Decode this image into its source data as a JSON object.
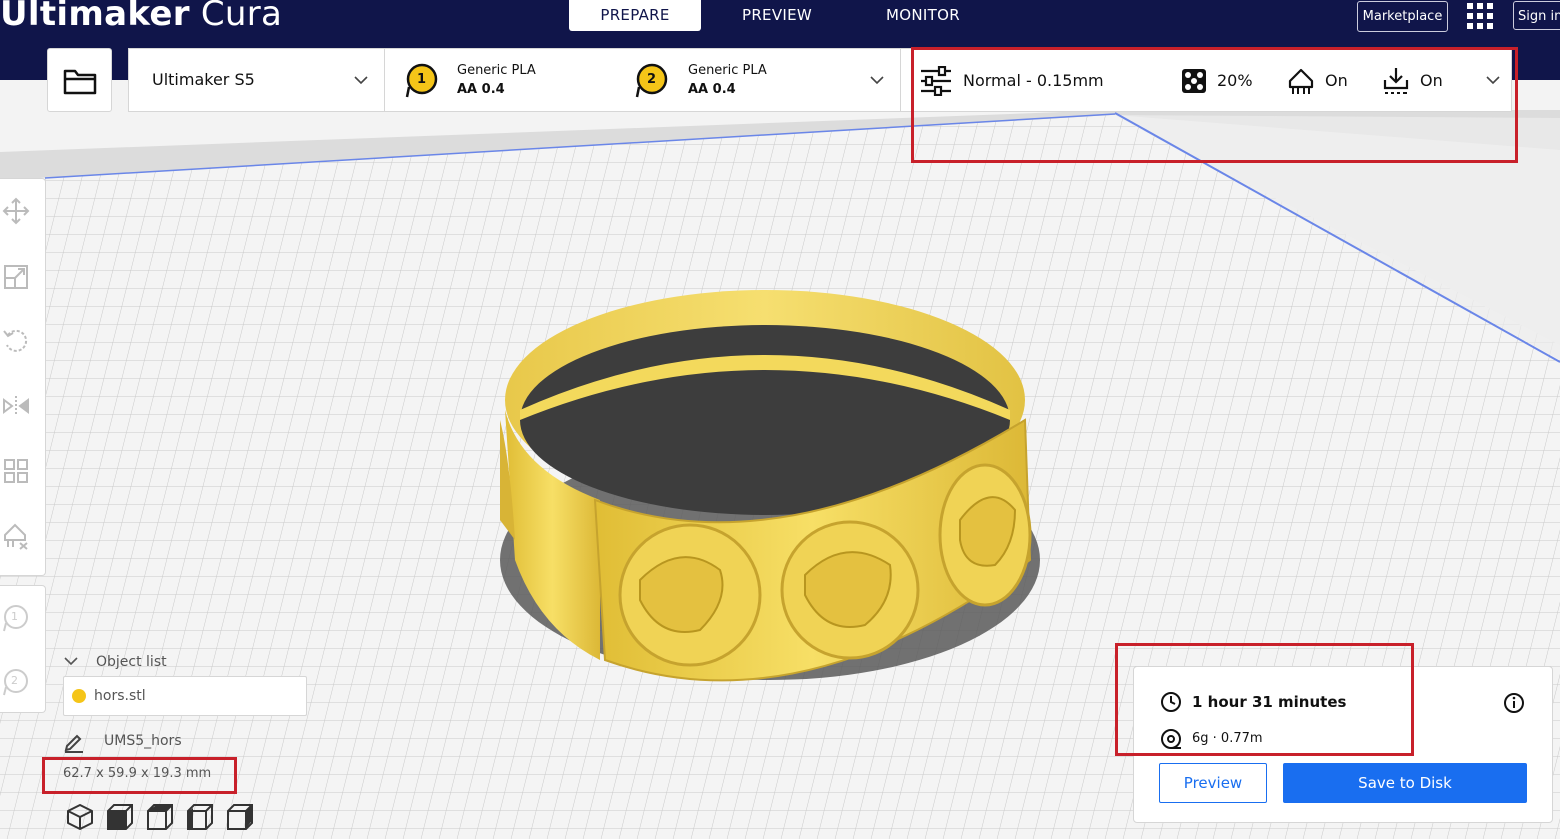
{
  "app": {
    "title_bold": "Ultimaker",
    "title_light": " Cura"
  },
  "nav": {
    "tabs": [
      {
        "label": "PREPARE",
        "active": true
      },
      {
        "label": "PREVIEW",
        "active": false
      },
      {
        "label": "MONITOR",
        "active": false
      }
    ],
    "marketplace_label": "Marketplace",
    "signin_label": "Sign in"
  },
  "printer": {
    "name": "Ultimaker S5"
  },
  "extruders": [
    {
      "number": "1",
      "material": "Generic PLA",
      "nozzle": "AA 0.4"
    },
    {
      "number": "2",
      "material": "Generic PLA",
      "nozzle": "AA 0.4"
    }
  ],
  "print_settings": {
    "profile": "Normal - 0.15mm",
    "infill": "20%",
    "support": "On",
    "adhesion": "On"
  },
  "object_list": {
    "header": "Object list",
    "items": [
      "hors.stl"
    ],
    "job_name": "UMS5_hors",
    "dimensions": "62.7 x 59.9 x 19.3 mm"
  },
  "estimate": {
    "time": "1 hour 31 minutes",
    "material": "6g · 0.77m",
    "preview_label": "Preview",
    "save_label": "Save to Disk"
  },
  "colors": {
    "navy": "#10154a",
    "accent_blue": "#196ef0",
    "highlight_red": "#c8202a",
    "model_yellow": "#f3d95c"
  }
}
